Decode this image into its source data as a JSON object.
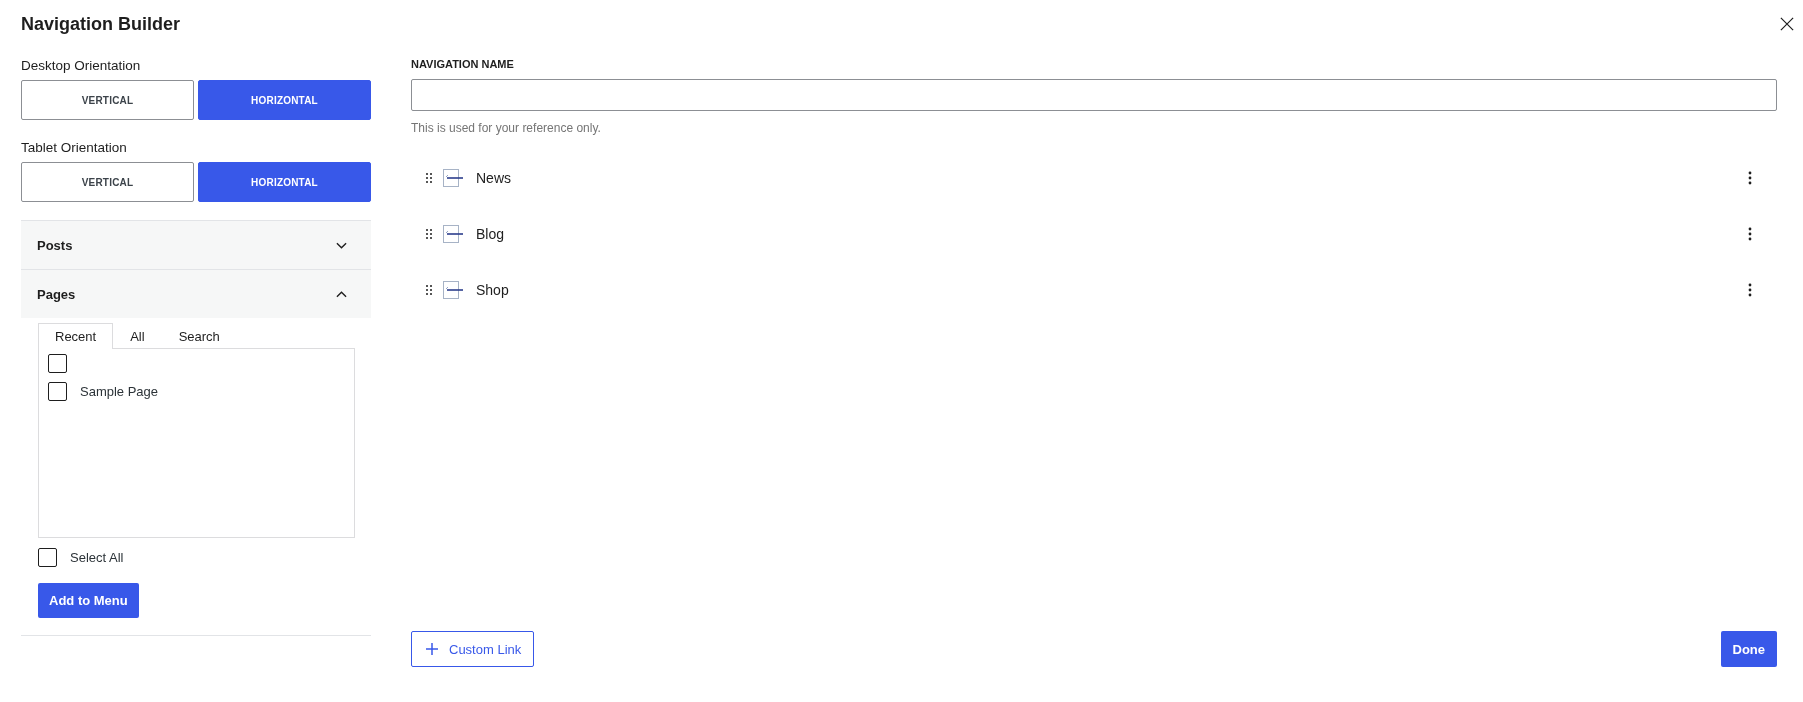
{
  "window": {
    "title": "Navigation Builder"
  },
  "orientation_settings": [
    {
      "label": "Desktop Orientation",
      "options": [
        {
          "label": "VERTICAL",
          "selected": false
        },
        {
          "label": "HORIZONTAL",
          "selected": true
        }
      ]
    },
    {
      "label": "Tablet Orientation",
      "options": [
        {
          "label": "VERTICAL",
          "selected": false
        },
        {
          "label": "HORIZONTAL",
          "selected": true
        }
      ]
    }
  ],
  "sections": [
    {
      "title": "Posts",
      "expanded": false
    },
    {
      "title": "Pages",
      "expanded": true,
      "tabs": [
        {
          "label": "Recent",
          "selected": true
        },
        {
          "label": "All",
          "selected": false
        },
        {
          "label": "Search",
          "selected": false
        }
      ],
      "items": [
        {
          "checked": false
        },
        {
          "label": "Sample Page",
          "checked": false
        }
      ],
      "select_all": {
        "label": "Select All",
        "checked": false
      },
      "add_button": "Add to Menu"
    }
  ],
  "navigation_name": {
    "label": "NAVIGATION NAME",
    "help": "This is used for your reference only."
  },
  "menu_items": [
    {
      "label": "News"
    },
    {
      "label": "Blog"
    },
    {
      "label": "Shop"
    }
  ],
  "custom_link_button": "Custom Link",
  "done_button": "Done"
}
